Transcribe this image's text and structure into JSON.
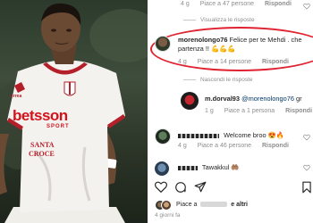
{
  "comments": {
    "top_meta": {
      "time": "4 g",
      "likes": "Piace a 47 persone",
      "reply": "Rispondi"
    },
    "top_toggle": "Visualizza le risposte",
    "main": {
      "username": "morenolongo76",
      "text_line1": "Felice per te Mehdi . che",
      "text_line2": "partenza !! 💪💪💪",
      "time": "4 g",
      "likes": "Piace a 14 persone",
      "reply": "Rispondi"
    },
    "hide_toggle": "Nascondi le risposte",
    "reply1": {
      "username": "m.dorval93",
      "mention": "@morenolongo76",
      "text": "gr",
      "time": "1 g",
      "likes": "Piace a 1 persona",
      "reply": "Rispondi"
    },
    "c2": {
      "text": "Welcome broo 😍🔥",
      "time": "4 g",
      "likes": "Piace a 46 persone",
      "reply": "Rispondi"
    },
    "c3": {
      "text": "Tawakkul 🤲🏽"
    }
  },
  "footer": {
    "likes_prefix": "Piace a",
    "likes_suffix": "e altri",
    "time_ago": "4 giorni fa"
  },
  "photo": {
    "sponsor": "betsson",
    "sponsor_sub": "SPORT",
    "chest_text_1": "SANTA",
    "chest_text_2": "CROCE",
    "brand": "errea"
  },
  "colors": {
    "highlight": "#e0212f",
    "jersey": "#f4f2ef",
    "jersey_trim": "#b51f2a",
    "sponsor_red": "#d3121c",
    "link": "#00376b",
    "muted": "#8e8e8e"
  }
}
